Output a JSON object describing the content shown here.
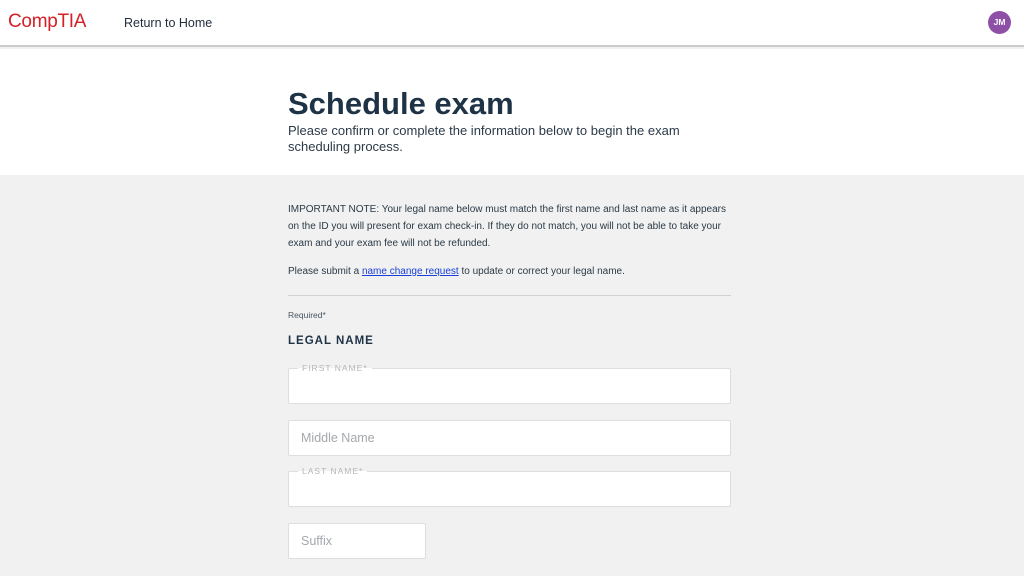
{
  "nav": {
    "logo_text": "CompTIA",
    "home_link": "Return to Home",
    "avatar_initials": "JM"
  },
  "header": {
    "title": "Schedule exam",
    "subtitle": "Please confirm or complete the information below to begin the exam scheduling process."
  },
  "form": {
    "important_note": "IMPORTANT NOTE: Your legal name below must match the first name and last name as it appears on the ID you will present for exam check-in. If they do not match, you will not be able to take your exam and your exam fee will not be refunded.",
    "submit_prefix": "Please submit a ",
    "submit_link": "name change request",
    "submit_suffix": " to update or correct your legal name.",
    "required_note": "Required*",
    "section_heading": "LEGAL NAME",
    "fields": {
      "first_name_label": "FIRST NAME*",
      "first_name_value": "",
      "middle_name_placeholder": "Middle Name",
      "middle_name_value": "",
      "last_name_label": "LAST NAME*",
      "last_name_value": "",
      "suffix_placeholder": "Suffix",
      "suffix_value": ""
    }
  },
  "colors": {
    "brand_red": "#d42026",
    "heading_navy": "#1f3347",
    "avatar_purple": "#8e50a6",
    "link_blue": "#1a3fd6",
    "page_background": "#f0f1f0"
  }
}
